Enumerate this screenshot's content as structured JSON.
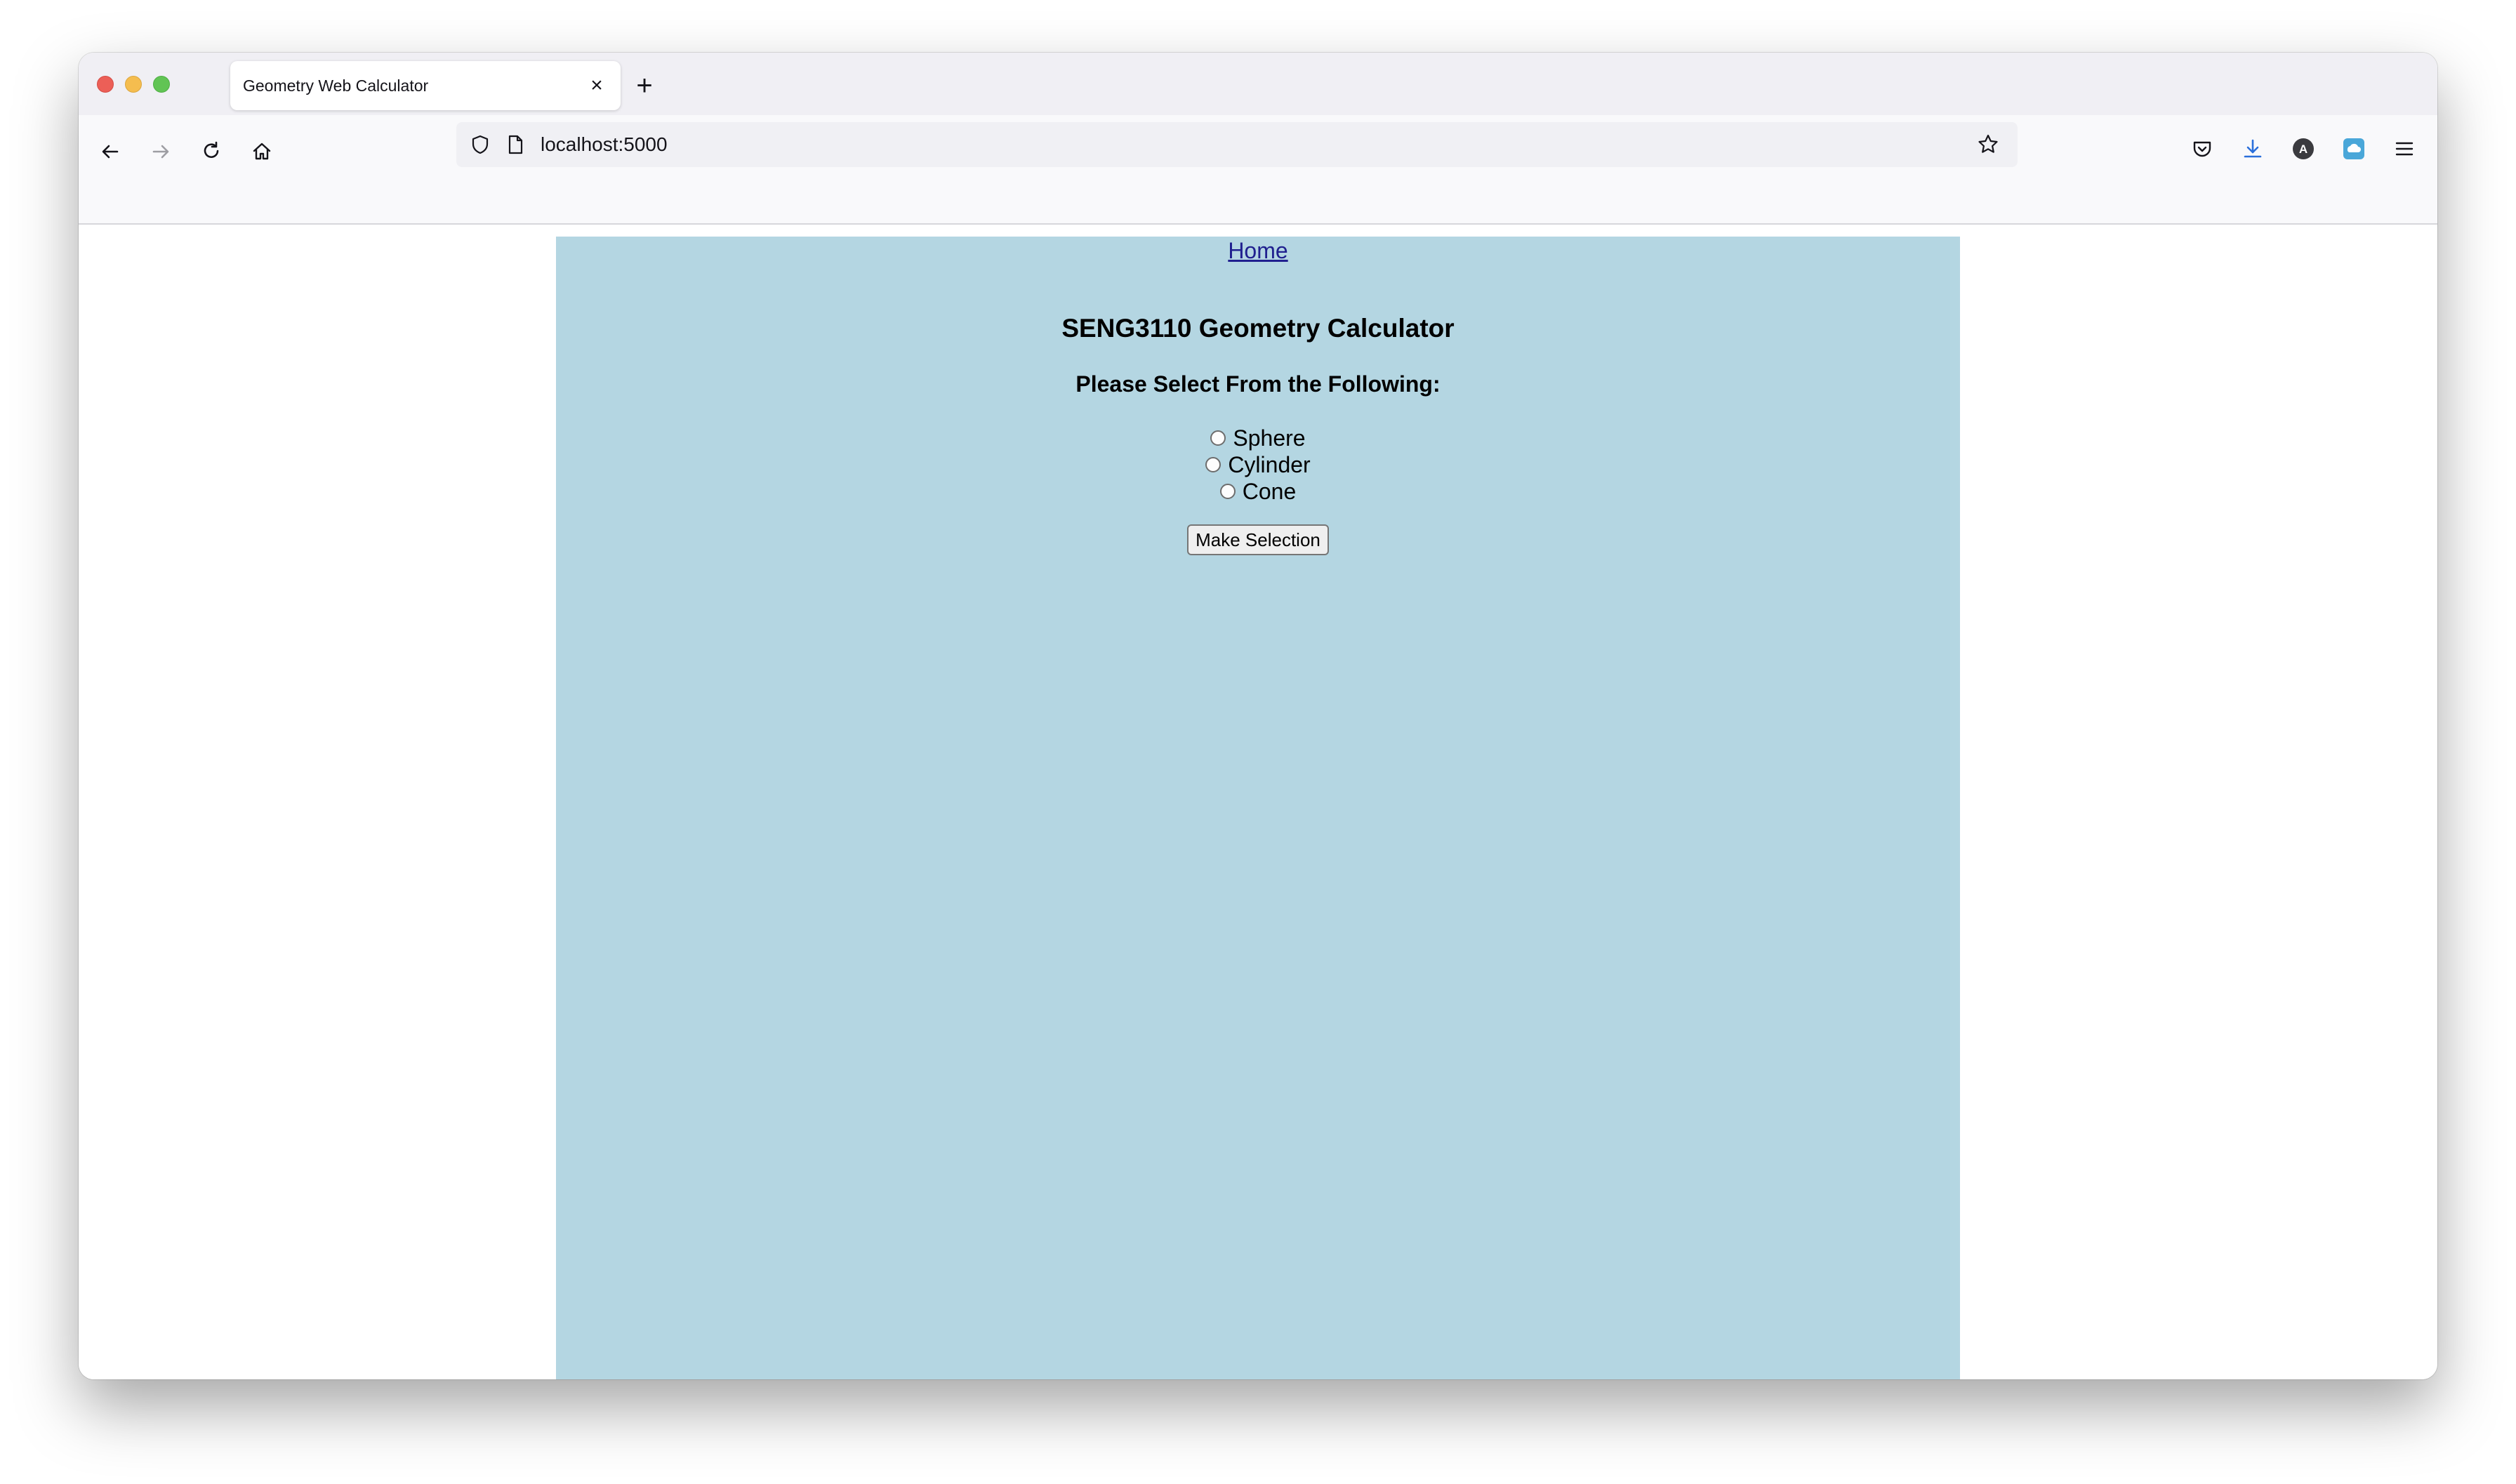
{
  "browser": {
    "tab_title": "Geometry Web Calculator",
    "url": "localhost:5000"
  },
  "page": {
    "nav_link": "Home",
    "title": "SENG3110 Geometry Calculator",
    "prompt": "Please Select From the Following:",
    "options": [
      {
        "label": "Sphere",
        "selected": false
      },
      {
        "label": "Cylinder",
        "selected": false
      },
      {
        "label": "Cone",
        "selected": false
      }
    ],
    "submit_label": "Make Selection",
    "background_color": "#b4d6e2"
  }
}
